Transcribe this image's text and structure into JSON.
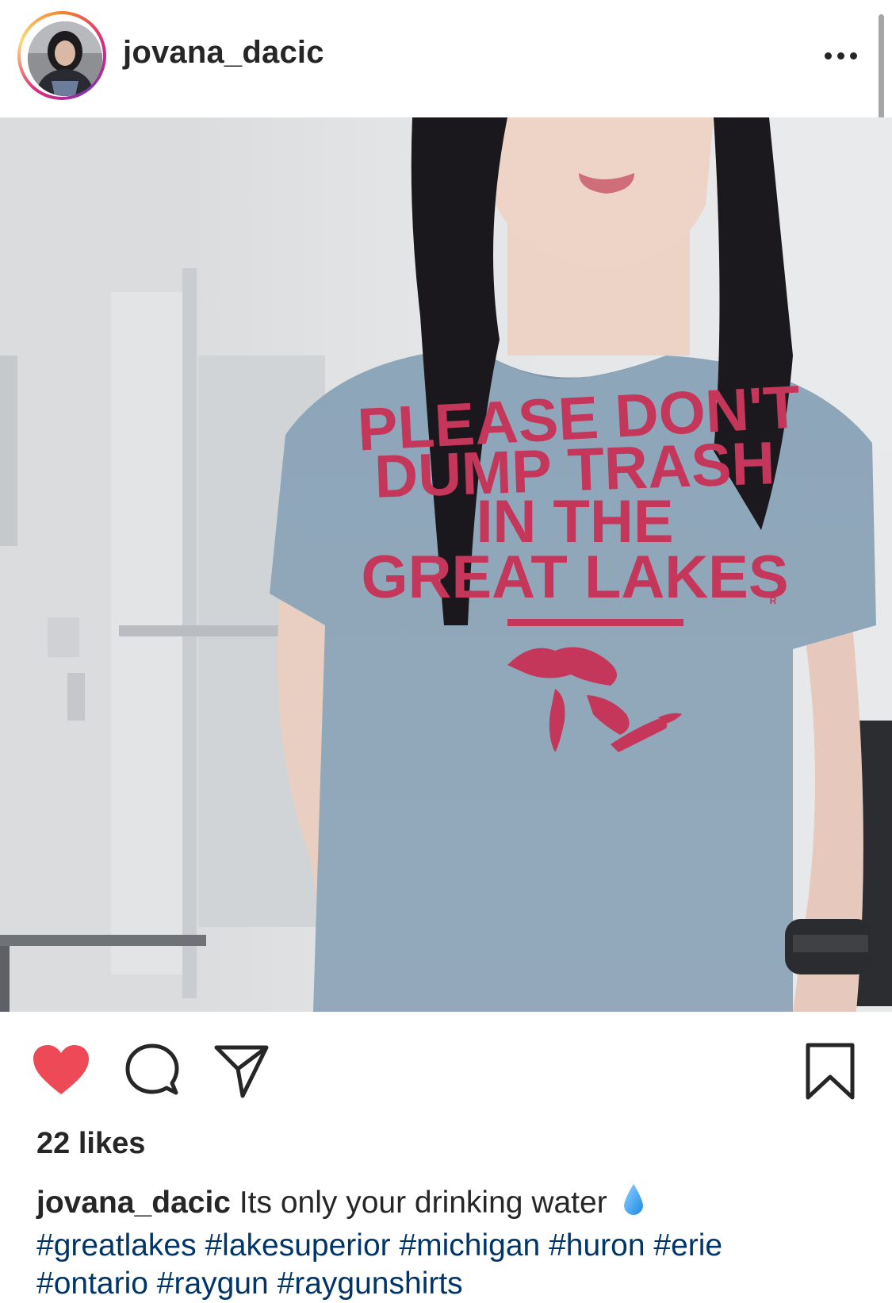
{
  "post": {
    "username": "jovana_dacic",
    "shirt_lines": [
      "PLEASE DON'T",
      "DUMP TRASH",
      "IN THE",
      "GREAT LAKES"
    ],
    "shirt_mark": "R",
    "likes_text": "22 likes",
    "caption": {
      "username": "jovana_dacic",
      "text": "Its only your drinking water",
      "emoji": "water-drop-icon",
      "hashtags": [
        "#greatlakes",
        "#lakesuperior",
        "#michigan",
        "#huron",
        "#erie",
        "#ontario",
        "#raygun",
        "#raygunshirts"
      ]
    },
    "liked": true
  },
  "colors": {
    "like_red": "#ed4956",
    "hashtag_blue": "#003569",
    "shirt_text_red": "#c4375a",
    "shirt_gray": "#8fa5b8"
  },
  "icons": {
    "more": "more-options-icon",
    "tag": "user-tag-icon",
    "like": "heart-icon",
    "comment": "comment-icon",
    "share": "share-icon",
    "save": "bookmark-icon"
  }
}
